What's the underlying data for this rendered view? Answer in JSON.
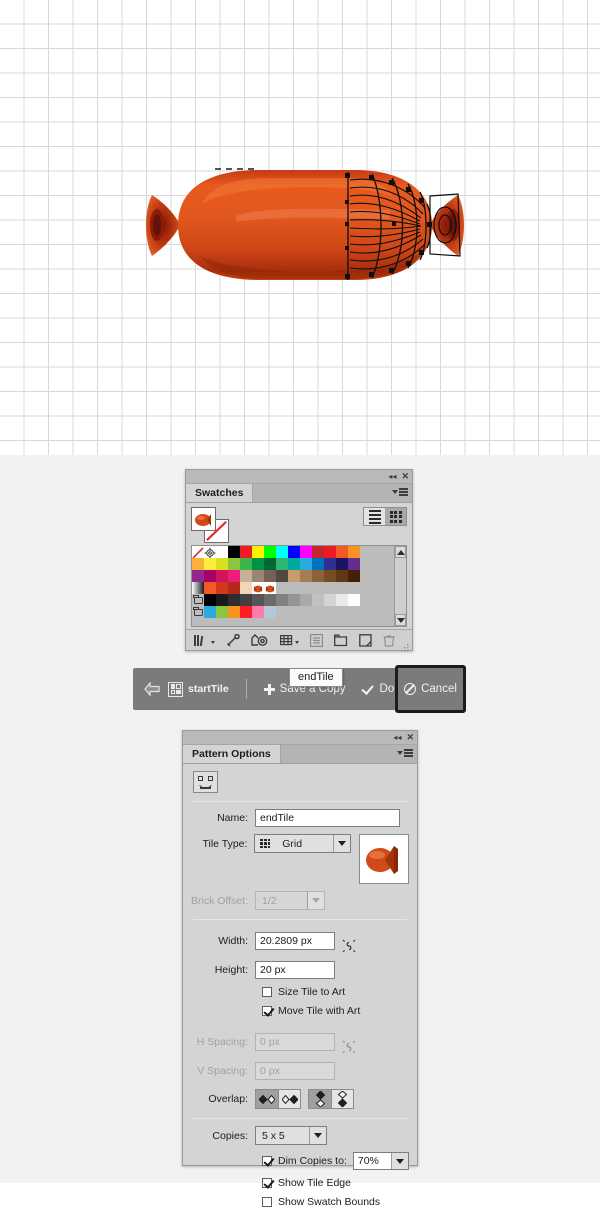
{
  "canvas": {
    "description": "Adobe Illustrator pattern-editing canvas with white grid background and a salami/sausage vector artwork",
    "grid_color": "#d8d8d8",
    "background": "#ffffff",
    "artwork_name": "sausage-pattern-artwork"
  },
  "swatches_panel": {
    "title": "Swatches",
    "collapse_icon": "double-chevron-left-icon",
    "close_icon": "close-icon",
    "menu_icon": "panel-menu-icon",
    "fill_label": "fill-swatch",
    "stroke_label": "stroke-none-swatch",
    "view_list_icon": "list-view-icon",
    "view_grid_icon": "grid-view-icon",
    "active_view": "grid",
    "tooltip": "endTile",
    "rows": [
      [
        "none",
        "registration",
        "#ffffff",
        "#000000",
        "#ed1c24",
        "#fff200",
        "#00ff00",
        "#00ffff",
        "#0000ff",
        "#ff00ff",
        "#c1272d",
        "#ed1c24",
        "#f15a24",
        "#f7931e"
      ],
      [
        "#fbb03b",
        "#ffec3b",
        "#d9e021",
        "#8cc63f",
        "#39b54a",
        "#009245",
        "#006837",
        "#2bb673",
        "#00a99d",
        "#29abe2",
        "#0071bc",
        "#2e3192",
        "#1b1464",
        "#662d91"
      ],
      [
        "#92278f",
        "#a6006b",
        "#d4145a",
        "#ed1e79",
        "#c7b299",
        "#998675",
        "#736357",
        "#534741",
        "#c69c6d",
        "#a67c52",
        "#8c6239",
        "#754c24",
        "#603813",
        "#42210b"
      ],
      [
        "gradient",
        "#f15a24",
        "#d4381a",
        "#b5291a",
        "#f5d6b4",
        "pattern-endtile",
        "pattern-endtile2",
        "",
        "",
        "",
        "",
        "",
        "",
        ""
      ],
      [
        "folder",
        "#000000",
        "#1a1a1a",
        "#2e2e2e",
        "#414141",
        "#565656",
        "#6b6b6b",
        "#808080",
        "#959595",
        "#aaaaaa",
        "#c0c0c0",
        "#d5d5d5",
        "#eaeaea",
        "#ffffff"
      ],
      [
        "folder",
        "#29abe2",
        "#8cc63f",
        "#f7931e",
        "#ff1d25",
        "#ff7bac",
        "#b3c8d6",
        "",
        "",
        "",
        "",
        "",
        "",
        ""
      ]
    ],
    "bottom_toolbar": [
      {
        "name": "swatch-libraries-menu-icon",
        "label": "Swatch Libraries menu"
      },
      {
        "name": "color-group-link-icon",
        "label": "Show Swatch Kinds menu"
      },
      {
        "name": "color-guide-icon",
        "label": "Color Guide"
      },
      {
        "name": "edit-color-group-icon",
        "label": "Edit or Apply Color Group"
      },
      {
        "name": "swatch-options-icon",
        "label": "Swatch Options"
      },
      {
        "name": "new-color-group-icon",
        "label": "New Color Group"
      },
      {
        "name": "new-swatch-icon",
        "label": "New Swatch"
      },
      {
        "name": "delete-swatch-icon",
        "label": "Delete Swatch"
      }
    ]
  },
  "pattern_toolbar": {
    "back_icon": "back-arrow-icon",
    "tile_icon": "pattern-tile-icon",
    "pattern_name": "startTile",
    "save_copy_label": "Save a Copy",
    "done_label": "Done",
    "cancel_label": "Cancel",
    "cancel_focused": true,
    "background": "#7b7b7b"
  },
  "pattern_options": {
    "title": "Pattern Options",
    "collapse_icon": "double-chevron-left-icon",
    "close_icon": "close-icon",
    "menu_icon": "panel-menu-icon",
    "tile_tool_label": "pattern-tile-tool",
    "name_label": "Name:",
    "name_value": "endTile",
    "tile_type_label": "Tile Type:",
    "tile_type_value": "Grid",
    "brick_offset_label": "Brick Offset:",
    "brick_offset_value": "1/2",
    "brick_offset_disabled": true,
    "width_label": "Width:",
    "width_value": "20.2809 px",
    "height_label": "Height:",
    "height_value": "20 px",
    "size_tile_to_art_label": "Size Tile to Art",
    "size_tile_to_art_checked": false,
    "move_tile_with_art_label": "Move Tile with Art",
    "move_tile_with_art_checked": true,
    "h_spacing_label": "H Spacing:",
    "h_spacing_value": "0 px",
    "h_spacing_disabled": true,
    "v_spacing_label": "V Spacing:",
    "v_spacing_value": "0 px",
    "v_spacing_disabled": true,
    "overlap_label": "Overlap:",
    "overlap_horizontal_selected": "left-in-front",
    "overlap_vertical_selected": "top-in-front",
    "copies_label": "Copies:",
    "copies_value": "5 x 5",
    "dim_copies_label": "Dim Copies to:",
    "dim_copies_checked": true,
    "dim_copies_value": "70%",
    "show_tile_edge_label": "Show Tile Edge",
    "show_tile_edge_checked": true,
    "show_swatch_bounds_label": "Show Swatch Bounds",
    "show_swatch_bounds_checked": false
  }
}
